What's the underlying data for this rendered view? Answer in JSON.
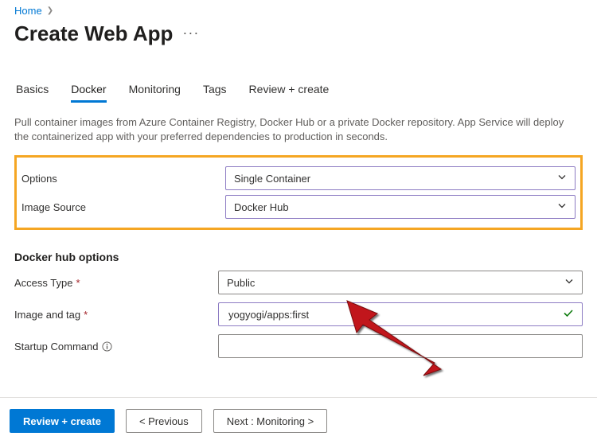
{
  "breadcrumb": {
    "home": "Home"
  },
  "title": "Create Web App",
  "tabs": [
    {
      "label": "Basics"
    },
    {
      "label": "Docker"
    },
    {
      "label": "Monitoring"
    },
    {
      "label": "Tags"
    },
    {
      "label": "Review + create"
    }
  ],
  "description": "Pull container images from Azure Container Registry, Docker Hub or a private Docker repository. App Service will deploy the containerized app with your preferred dependencies to production in seconds.",
  "form": {
    "options_label": "Options",
    "options_value": "Single Container",
    "image_source_label": "Image Source",
    "image_source_value": "Docker Hub",
    "section_header": "Docker hub options",
    "access_type_label": "Access Type",
    "access_type_value": "Public",
    "image_tag_label": "Image and tag",
    "image_tag_value": "yogyogi/apps:first",
    "startup_label": "Startup Command",
    "startup_value": ""
  },
  "buttons": {
    "review": "Review + create",
    "previous": "< Previous",
    "next": "Next : Monitoring >"
  }
}
